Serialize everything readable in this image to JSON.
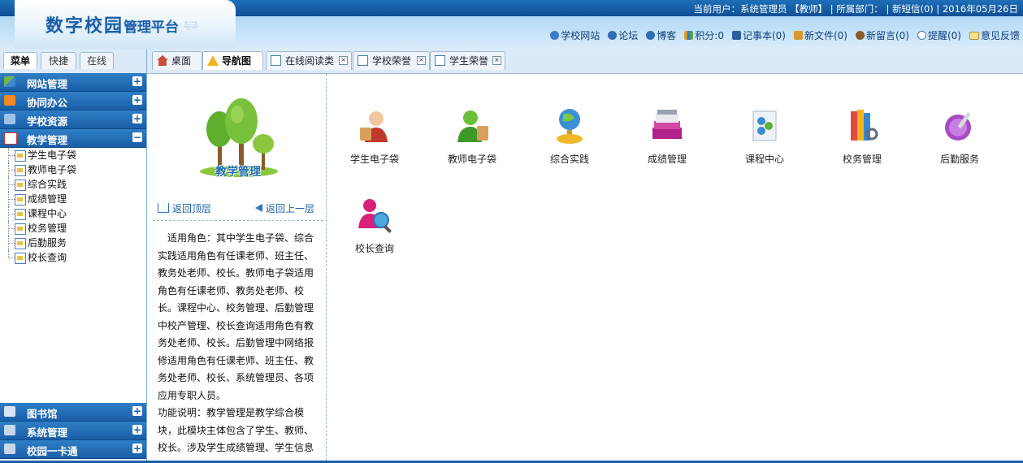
{
  "header": {
    "logo_main": "数字校园",
    "logo_sub": "管理平台",
    "user_info": "当前用户：系统管理员 【教师】 | 所属部门： | 新短信(0) | 2016年05月26日",
    "links": [
      {
        "label": "学校网站",
        "icon": "globe-icon"
      },
      {
        "label": "论坛",
        "icon": "forum-icon"
      },
      {
        "label": "博客",
        "icon": "blog-icon"
      },
      {
        "label": "积分:0",
        "icon": "points-icon"
      },
      {
        "label": "记事本(0)",
        "icon": "notebook-icon"
      },
      {
        "label": "新文件(0)",
        "icon": "file-icon"
      },
      {
        "label": "新留言(0)",
        "icon": "message-icon"
      },
      {
        "label": "提醒(0)",
        "icon": "info-icon"
      },
      {
        "label": "意见反馈",
        "icon": "feedback-icon"
      }
    ]
  },
  "left_tabs": [
    "菜单",
    "快捷",
    "在线"
  ],
  "menu": {
    "top_sections": [
      {
        "label": "网站管理",
        "icon": "website-icon",
        "toggle": "+"
      },
      {
        "label": "协同办公",
        "icon": "rss-icon",
        "toggle": "+"
      },
      {
        "label": "学校资源",
        "icon": "resource-icon",
        "toggle": "+"
      },
      {
        "label": "教学管理",
        "icon": "teaching-icon",
        "toggle": "−"
      }
    ],
    "sub_items": [
      "学生电子袋",
      "教师电子袋",
      "综合实践",
      "成绩管理",
      "课程中心",
      "校务管理",
      "后勤服务",
      "校长查询"
    ],
    "bottom_sections": [
      {
        "label": "图书馆",
        "icon": "library-icon",
        "toggle": "+"
      },
      {
        "label": "系统管理",
        "icon": "tools-icon",
        "toggle": "+"
      },
      {
        "label": "校园一卡通",
        "icon": "card-icon",
        "toggle": "+"
      }
    ]
  },
  "tabs": [
    {
      "label": "桌面",
      "closable": false,
      "active": false
    },
    {
      "label": "导航图",
      "closable": false,
      "active": true
    },
    {
      "label": "在线阅读类",
      "closable": true,
      "active": false
    },
    {
      "label": "学校荣誉",
      "closable": true,
      "active": false
    },
    {
      "label": "学生荣誉",
      "closable": true,
      "active": false
    }
  ],
  "panel": {
    "title": "教学管理",
    "back_top": "返回顶层",
    "back_up": "返回上一层",
    "desc_role": "适用角色：其中学生电子袋、综合实践适用角色有任课老师、班主任、教务处老师、校长。教师电子袋适用角色有任课老师、教务处老师、校长。课程中心、校务管理、后勤管理中校产管理、校长查询适用角色有教务处老师、校长。后勤管理中网络报修适用角色有任课老师、班主任、教务处老师、校长、系统管理员、各项应用专职人员。",
    "desc_func": "功能说明：教学管理是教学综合模块，此模块主体包含了学生、教师、校长。涉及学生成绩管理、学生信息"
  },
  "modules": [
    {
      "label": "学生电子袋",
      "icon": "student-bag-icon"
    },
    {
      "label": "教师电子袋",
      "icon": "teacher-bag-icon"
    },
    {
      "label": "综合实践",
      "icon": "globe-practice-icon"
    },
    {
      "label": "成绩管理",
      "icon": "grades-icon"
    },
    {
      "label": "课程中心",
      "icon": "course-center-icon"
    },
    {
      "label": "校务管理",
      "icon": "books-icon"
    },
    {
      "label": "后勤服务",
      "icon": "service-icon"
    },
    {
      "label": "校长查询",
      "icon": "principal-search-icon"
    }
  ]
}
